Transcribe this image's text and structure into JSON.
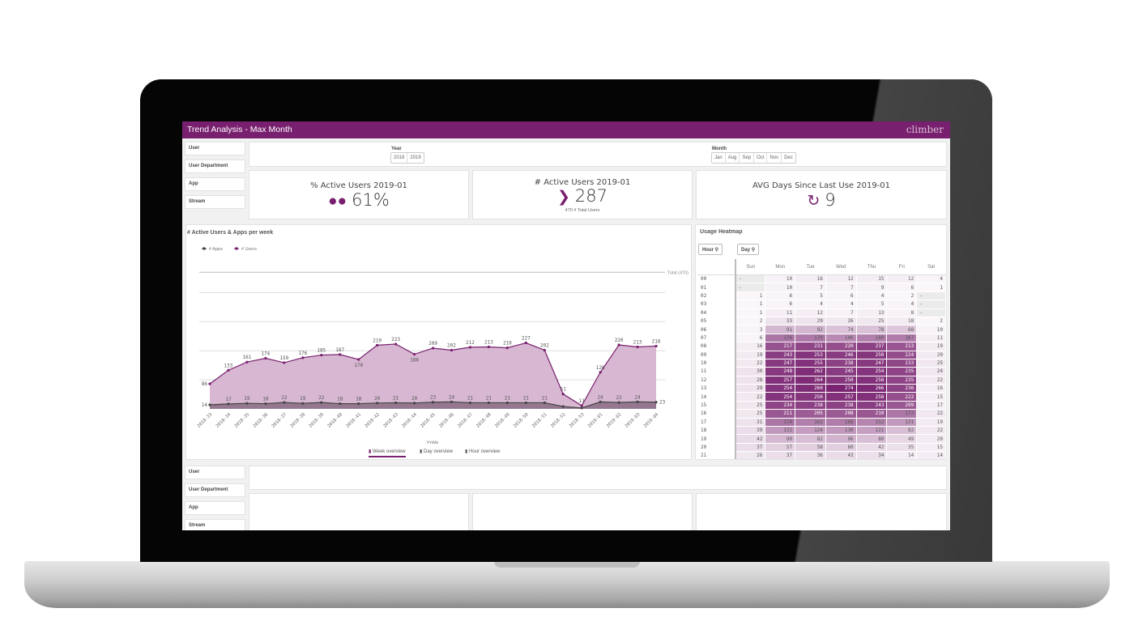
{
  "app": {
    "title": "Trend Analysis - Max Month",
    "logo": "climber",
    "accent": "#78206f"
  },
  "filters": [
    {
      "label": "User"
    },
    {
      "label": "User Department"
    },
    {
      "label": "App"
    },
    {
      "label": "Stream"
    }
  ],
  "year": {
    "label": "Year",
    "options": [
      "2018",
      "2019"
    ]
  },
  "month": {
    "label": "Month",
    "options": [
      "Jan",
      "Aug",
      "Sep",
      "Oct",
      "Nov",
      "Dec"
    ]
  },
  "kpis": [
    {
      "title": "% Active Users 2019-01",
      "value": "61%",
      "icon": "users-icon"
    },
    {
      "title": "# Active Users 2019-01",
      "value": "287",
      "sub": "470 # Total Users",
      "icon": "chevron-right-icon"
    },
    {
      "title": "AVG Days Since Last Use 2019-01",
      "value": "9",
      "icon": "refresh-clock-icon"
    }
  ],
  "chart_tabs": [
    "Week overview",
    "Day overview",
    "Hour overview"
  ],
  "chart_data": {
    "type": "area",
    "title": "# Active Users & Apps per week",
    "xlabel": "YrWk",
    "ylim": [
      0,
      470
    ],
    "grid": true,
    "legend": "top-left",
    "reference_line": {
      "label": "Total (470)",
      "value": 470
    },
    "x": [
      "2018-33",
      "2018-34",
      "2018-35",
      "2018-36",
      "2018-37",
      "2018-38",
      "2018-39",
      "2018-40",
      "2018-41",
      "2018-42",
      "2018-43",
      "2018-44",
      "2018-45",
      "2018-46",
      "2018-47",
      "2018-48",
      "2018-49",
      "2018-50",
      "2018-51",
      "2018-52",
      "2018-53",
      "2019-01",
      "2019-02",
      "2019-03",
      "2019-04"
    ],
    "series": [
      {
        "name": "# Apps",
        "color": "#444444",
        "values": [
          14,
          17,
          19,
          18,
          22,
          19,
          22,
          18,
          18,
          20,
          21,
          20,
          23,
          24,
          21,
          21,
          21,
          21,
          21,
          8,
          3,
          24,
          22,
          24,
          23
        ],
        "labeled": [
          true,
          true,
          true,
          true,
          true,
          true,
          true,
          true,
          true,
          true,
          true,
          true,
          true,
          true,
          true,
          true,
          true,
          true,
          true,
          false,
          false,
          true,
          true,
          true,
          true
        ]
      },
      {
        "name": "# Users",
        "color": "#78206f",
        "values": [
          86,
          133,
          161,
          174,
          159,
          176,
          185,
          187,
          170,
          219,
          223,
          188,
          209,
          202,
          212,
          213,
          210,
          227,
          202,
          51,
          11,
          126,
          220,
          213,
          216
        ]
      }
    ]
  },
  "heatmap": {
    "title": "Usage Heatmap",
    "row_search": "Hour",
    "col_search": "Day",
    "days": [
      "Sun",
      "Mon",
      "Tue",
      "Wed",
      "Thu",
      "Fri",
      "Sat"
    ],
    "rows": [
      {
        "hour": "00",
        "v": [
          "-",
          10,
          16,
          12,
          15,
          12,
          4
        ]
      },
      {
        "hour": "01",
        "v": [
          "-",
          10,
          7,
          7,
          9,
          6,
          1
        ]
      },
      {
        "hour": "02",
        "v": [
          1,
          6,
          5,
          6,
          4,
          2,
          "-"
        ]
      },
      {
        "hour": "03",
        "v": [
          1,
          6,
          4,
          4,
          5,
          4,
          "-"
        ]
      },
      {
        "hour": "04",
        "v": [
          1,
          11,
          12,
          7,
          13,
          8,
          "-"
        ]
      },
      {
        "hour": "05",
        "v": [
          2,
          33,
          29,
          26,
          25,
          18,
          2
        ]
      },
      {
        "hour": "06",
        "v": [
          3,
          91,
          92,
          74,
          78,
          68,
          10
        ]
      },
      {
        "hour": "07",
        "v": [
          6,
          176,
          170,
          146,
          160,
          167,
          11
        ]
      },
      {
        "hour": "08",
        "v": [
          16,
          217,
          231,
          220,
          237,
          213,
          19
        ]
      },
      {
        "hour": "09",
        "v": [
          19,
          243,
          253,
          246,
          250,
          224,
          20
        ]
      },
      {
        "hour": "10",
        "v": [
          22,
          247,
          255,
          238,
          247,
          233,
          25
        ]
      },
      {
        "hour": "11",
        "v": [
          30,
          248,
          262,
          245,
          254,
          235,
          24
        ]
      },
      {
        "hour": "12",
        "v": [
          28,
          257,
          264,
          250,
          258,
          235,
          22
        ]
      },
      {
        "hour": "13",
        "v": [
          29,
          254,
          260,
          274,
          266,
          236,
          16
        ]
      },
      {
        "hour": "14",
        "v": [
          22,
          254,
          250,
          257,
          258,
          222,
          15
        ]
      },
      {
        "hour": "15",
        "v": [
          25,
          234,
          238,
          238,
          243,
          209,
          17
        ]
      },
      {
        "hour": "16",
        "v": [
          25,
          211,
          205,
          208,
          210,
          173,
          22
        ]
      },
      {
        "hour": "17",
        "v": [
          31,
          174,
          162,
          168,
          152,
          131,
          19
        ]
      },
      {
        "hour": "18",
        "v": [
          39,
          131,
          124,
          130,
          121,
          82,
          22
        ]
      },
      {
        "hour": "19",
        "v": [
          42,
          90,
          82,
          96,
          80,
          49,
          20
        ]
      },
      {
        "hour": "20",
        "v": [
          37,
          57,
          58,
          60,
          42,
          35,
          15
        ]
      },
      {
        "hour": "21",
        "v": [
          26,
          37,
          36,
          43,
          34,
          14,
          14
        ]
      }
    ]
  }
}
